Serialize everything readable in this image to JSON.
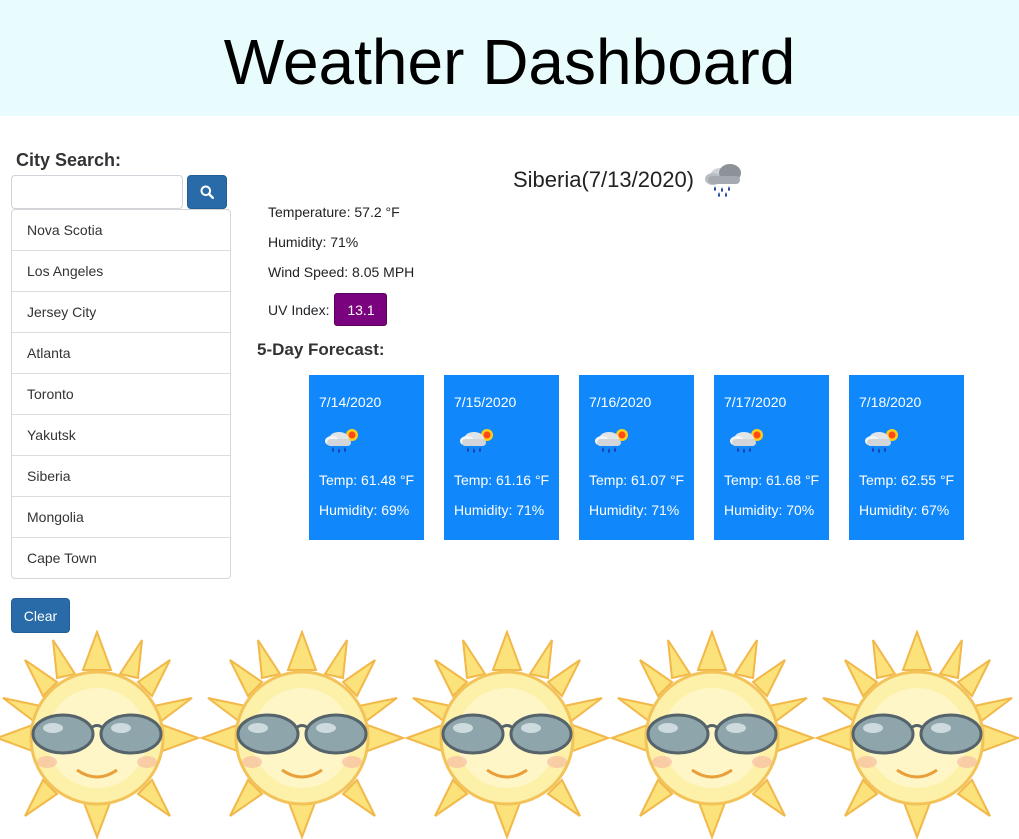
{
  "header": {
    "title": "Weather Dashboard"
  },
  "search": {
    "label": "City Search:",
    "value": "",
    "placeholder": "",
    "button_icon": "search-icon"
  },
  "cities": [
    "Nova Scotia",
    "Los Angeles",
    "Jersey City",
    "Atlanta",
    "Toronto",
    "Yakutsk",
    "Siberia",
    "Mongolia",
    "Cape Town"
  ],
  "clear_label": "Clear",
  "current": {
    "title": "Siberia(7/13/2020)",
    "icon": "rain-cloud-icon",
    "temperature": "Temperature: 57.2 °F",
    "humidity": "Humidity: 71%",
    "wind": "Wind Speed: 8.05 MPH",
    "uv_label": "UV Index:",
    "uv_value": "13.1",
    "uv_color": "#7a027e"
  },
  "forecast": {
    "title": "5-Day Forecast:",
    "days": [
      {
        "date": "7/14/2020",
        "icon": "rain-sun-cloud-icon",
        "temp": "Temp: 61.48 °F",
        "humidity": "Humidity: 69%"
      },
      {
        "date": "7/15/2020",
        "icon": "rain-sun-cloud-icon",
        "temp": "Temp: 61.16 °F",
        "humidity": "Humidity: 71%"
      },
      {
        "date": "7/16/2020",
        "icon": "rain-sun-cloud-icon",
        "temp": "Temp: 61.07 °F",
        "humidity": "Humidity: 71%"
      },
      {
        "date": "7/17/2020",
        "icon": "rain-sun-cloud-icon",
        "temp": "Temp: 61.68 °F",
        "humidity": "Humidity: 70%"
      },
      {
        "date": "7/18/2020",
        "icon": "rain-sun-cloud-icon",
        "temp": "Temp: 62.55 °F",
        "humidity": "Humidity: 67%"
      }
    ]
  },
  "colors": {
    "header_bg": "#e8fcfd",
    "button": "#286ba8",
    "card": "#1088fb"
  },
  "background_icon": "sunglasses-sun-icon"
}
